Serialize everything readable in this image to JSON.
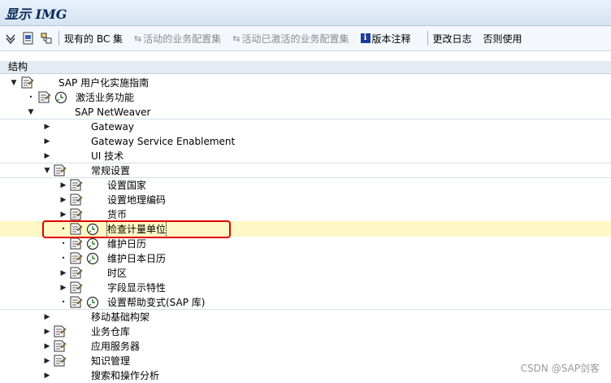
{
  "title": "显示 IMG",
  "toolbar": {
    "bc_sets": "现有的 BC 集",
    "activated_bc_sets": "活动的业务配置集",
    "activated_bc_sets_for_activity": "活动已激活的业务配置集",
    "release_notes": "版本注释",
    "change_log": "更改日志",
    "whether_used": "否则使用"
  },
  "tree_header": "结构",
  "tree": [
    {
      "label": "SAP 用户化实施指南",
      "level": 0,
      "toggle": "expanded",
      "doc": true,
      "clock": false
    },
    {
      "label": "激活业务功能",
      "level": 1,
      "toggle": "leaf",
      "doc": true,
      "clock": true
    },
    {
      "label": "SAP NetWeaver",
      "level": 1,
      "toggle": "expanded",
      "doc": false,
      "clock": false
    },
    {
      "label": "Gateway",
      "level": 2,
      "toggle": "collapsed",
      "doc": false,
      "clock": false,
      "group": true
    },
    {
      "label": "Gateway Service Enablement",
      "level": 2,
      "toggle": "collapsed",
      "doc": false,
      "clock": false
    },
    {
      "label": "UI 技术",
      "level": 2,
      "toggle": "collapsed",
      "doc": false,
      "clock": false
    },
    {
      "label": "常规设置",
      "level": 2,
      "toggle": "expanded",
      "doc": true,
      "clock": false,
      "group": true
    },
    {
      "label": "设置国家",
      "level": 3,
      "toggle": "collapsed",
      "doc": true,
      "clock": false,
      "group": true
    },
    {
      "label": "设置地理编码",
      "level": 3,
      "toggle": "collapsed",
      "doc": true,
      "clock": false
    },
    {
      "label": "货币",
      "level": 3,
      "toggle": "collapsed",
      "doc": true,
      "clock": false
    },
    {
      "label": "检查计量单位",
      "level": 3,
      "toggle": "leaf",
      "doc": true,
      "clock": true,
      "selected": true
    },
    {
      "label": "维护日历",
      "level": 3,
      "toggle": "leaf",
      "doc": true,
      "clock": true
    },
    {
      "label": "维护日本日历",
      "level": 3,
      "toggle": "leaf",
      "doc": true,
      "clock": true
    },
    {
      "label": "时区",
      "level": 3,
      "toggle": "collapsed",
      "doc": true,
      "clock": false
    },
    {
      "label": "字段显示特性",
      "level": 3,
      "toggle": "collapsed",
      "doc": true,
      "clock": false
    },
    {
      "label": "设置帮助变式(SAP 库)",
      "level": 3,
      "toggle": "leaf",
      "doc": true,
      "clock": true
    },
    {
      "label": "移动基础构架",
      "level": 2,
      "toggle": "collapsed",
      "doc": false,
      "clock": false,
      "group": true
    },
    {
      "label": "业务仓库",
      "level": 2,
      "toggle": "collapsed",
      "doc": true,
      "clock": false
    },
    {
      "label": "应用服务器",
      "level": 2,
      "toggle": "collapsed",
      "doc": true,
      "clock": false
    },
    {
      "label": "知识管理",
      "level": 2,
      "toggle": "collapsed",
      "doc": true,
      "clock": false
    },
    {
      "label": "搜索和操作分析",
      "level": 2,
      "toggle": "collapsed",
      "doc": false,
      "clock": false
    }
  ],
  "watermark": "CSDN @SAP剑客",
  "colors": {
    "selected_row": "#fff8c4",
    "highlight_box": "#e00000"
  }
}
